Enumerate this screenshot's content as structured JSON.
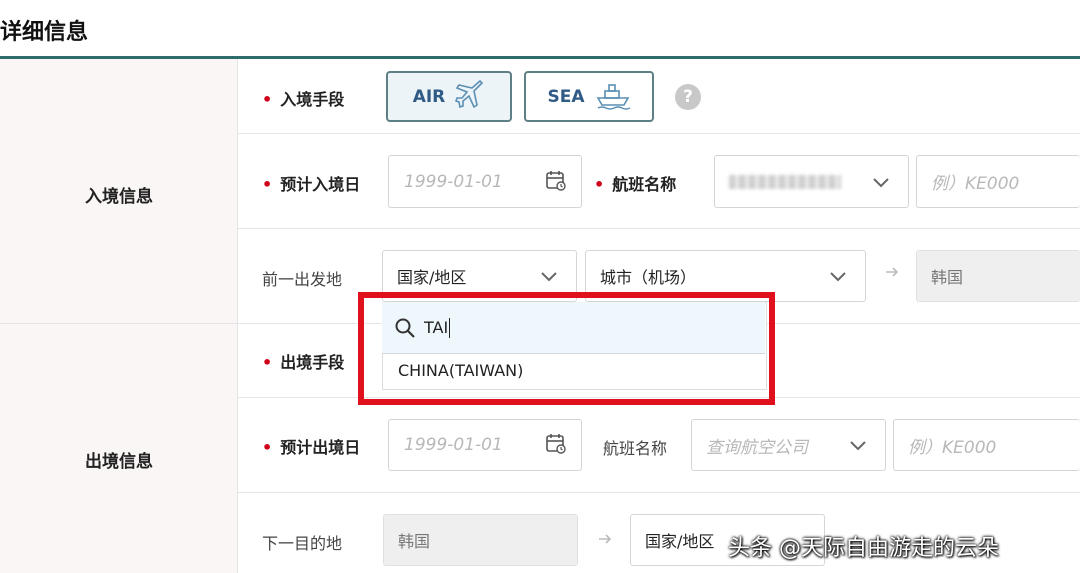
{
  "page": {
    "title": "详细信息"
  },
  "entry": {
    "section_label": "入境信息",
    "mode_label": "入境手段",
    "modes": [
      {
        "label": "AIR",
        "active": true
      },
      {
        "label": "SEA",
        "active": false
      }
    ],
    "help_glyph": "?",
    "date_label": "预计入境日",
    "date_placeholder": "1999-01-01",
    "flight_label": "航班名称",
    "flight_placeholder": "例）KE000",
    "prev_origin_label": "前一出发地",
    "country_select": "国家/地区",
    "city_select": "城市（机场）",
    "destination_value": "韩国"
  },
  "dropdown": {
    "search_value": "TAI",
    "options": [
      "CHINA(TAIWAN)"
    ]
  },
  "exit": {
    "section_label": "出境信息",
    "mode_label": "出境手段",
    "date_label": "预计出境日",
    "date_placeholder": "1999-01-01",
    "flight_label": "航班名称",
    "airline_placeholder": "查询航空公司",
    "flight_placeholder": "例）KE000",
    "next_dest_label": "下一目的地",
    "origin_value": "韩国",
    "country_select": "国家/地区"
  },
  "watermark": "头条 @天际自由游走的云朵",
  "colors": {
    "accent": "#2e6b6b",
    "required": "#d0021b",
    "highlight": "#e0101d"
  }
}
